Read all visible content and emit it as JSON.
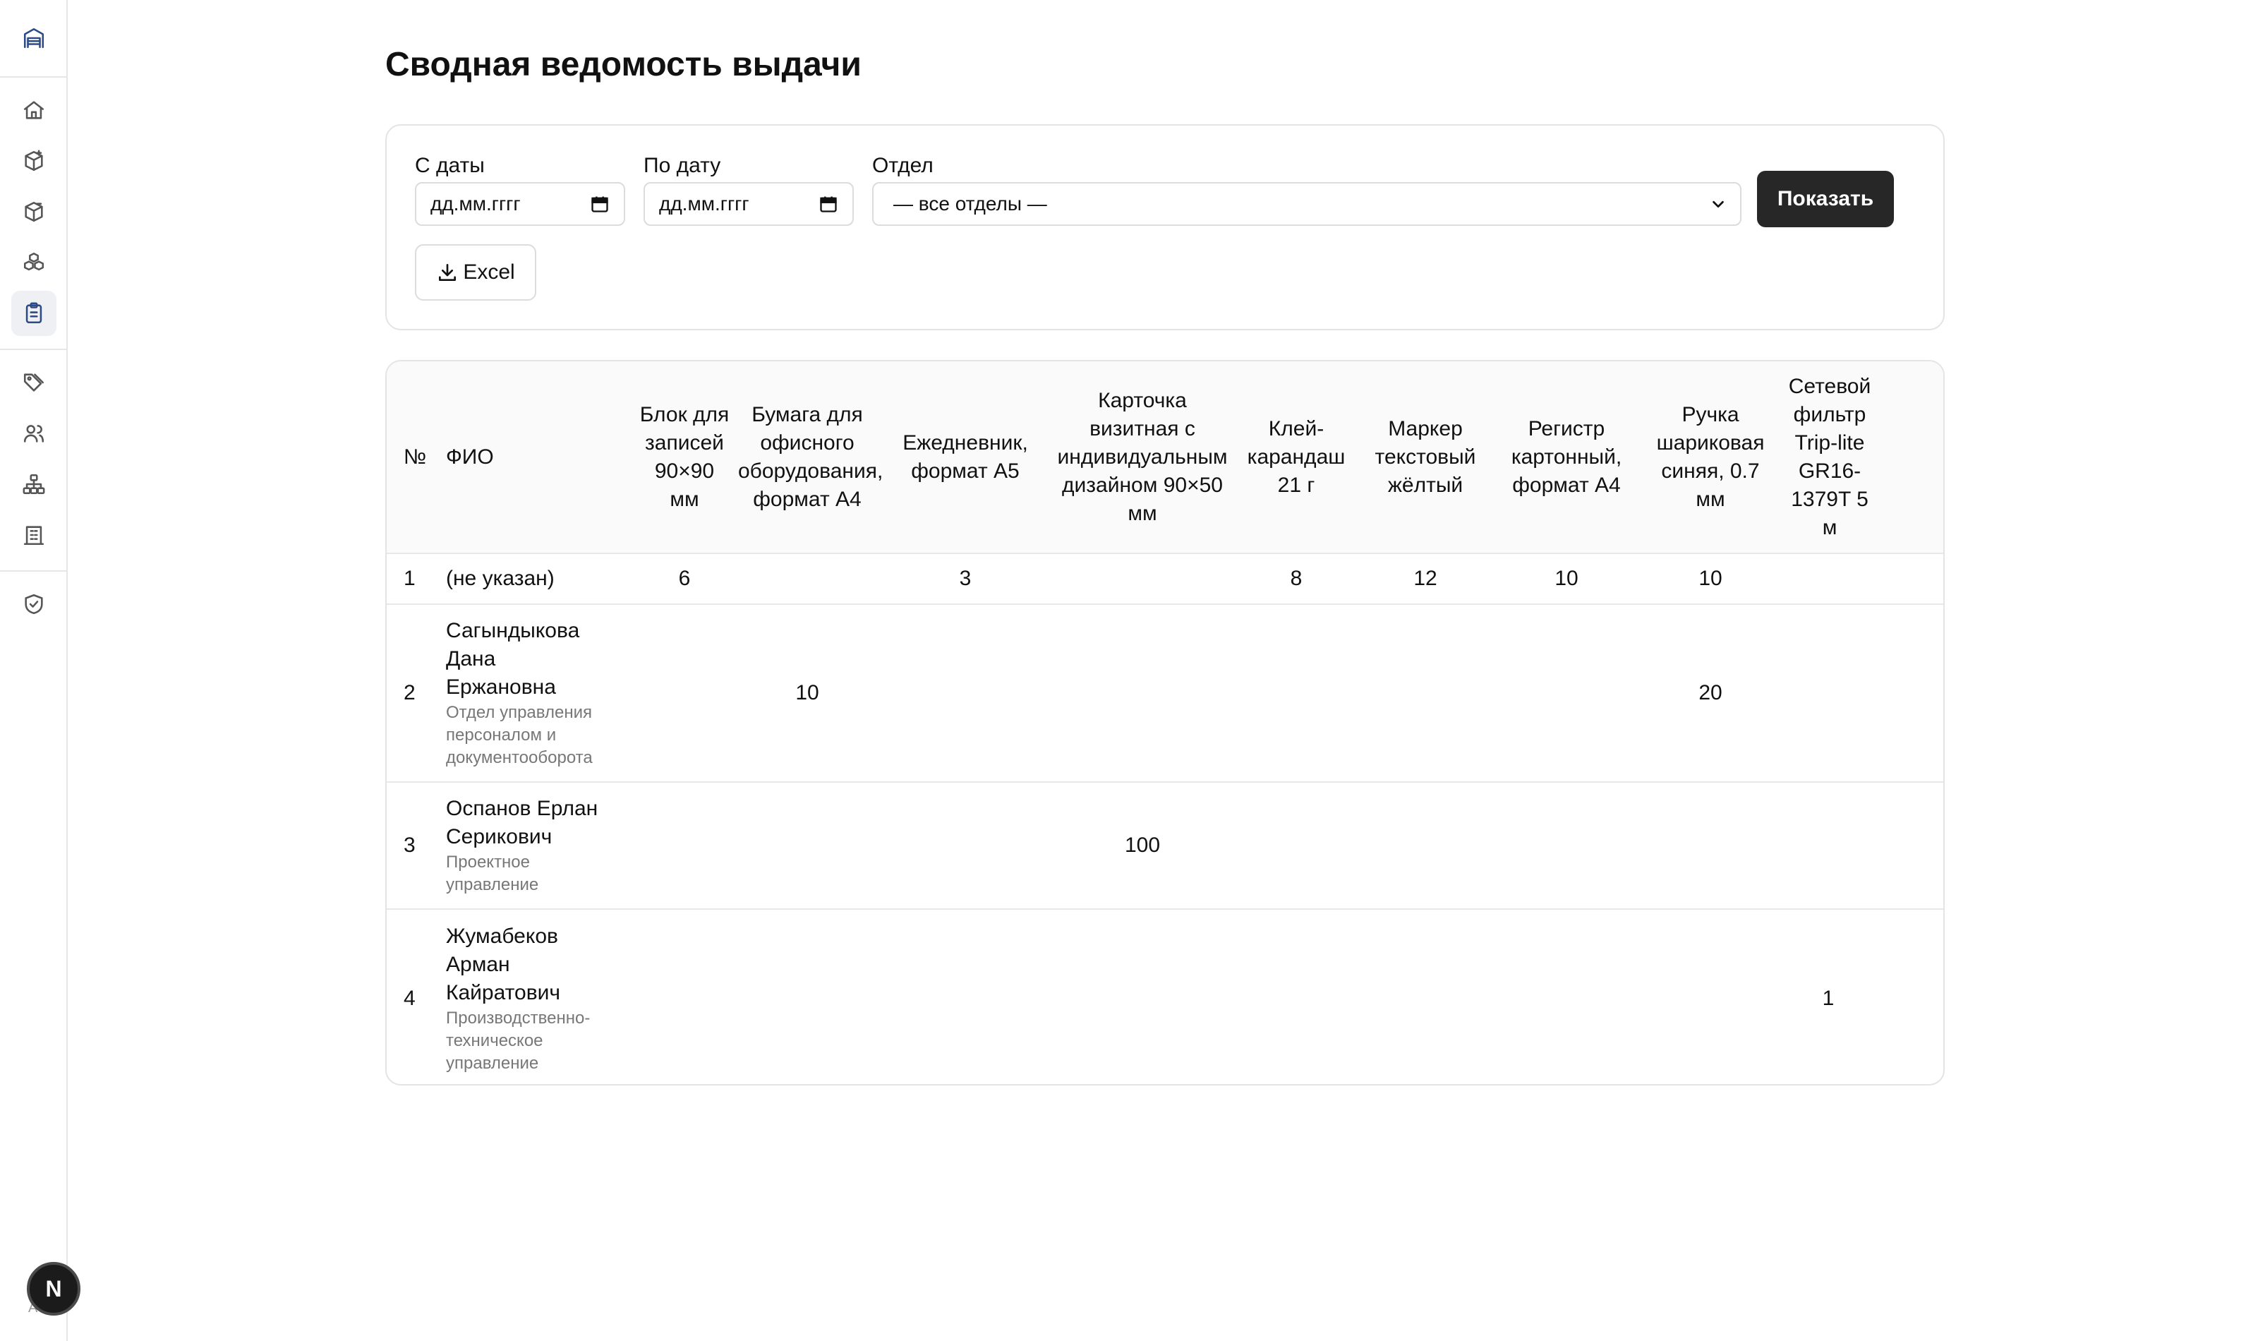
{
  "page": {
    "title": "Сводная ведомость выдачи"
  },
  "sidebar": {
    "items": [
      {
        "icon": "warehouse-icon"
      },
      {
        "icon": "home-icon"
      },
      {
        "icon": "box-plus-icon"
      },
      {
        "icon": "box-minus-icon"
      },
      {
        "icon": "boxes-icon"
      },
      {
        "icon": "clipboard-list-icon",
        "active": true
      },
      {
        "icon": "tags-icon"
      },
      {
        "icon": "users-icon"
      },
      {
        "icon": "org-chart-icon"
      },
      {
        "icon": "building-icon"
      },
      {
        "icon": "shield-check-icon"
      }
    ],
    "avatar_letter": "N",
    "avatar_sub": "А"
  },
  "filters": {
    "from_label": "С даты",
    "from_value": "дд.мм.гггг",
    "to_label": "По дату",
    "to_value": "дд.мм.гггг",
    "dept_label": "Отдел",
    "dept_value": "— все отделы —",
    "show_button": "Показать",
    "excel_button": "Excel"
  },
  "table": {
    "headers": [
      "№",
      "ФИО",
      "Блок для записей 90×90 мм",
      "Бумага для офисного оборудования, формат А4",
      "Ежедневник, формат А5",
      "Карточка визитная с индивидуальным дизайном 90×50 мм",
      "Клей-карандаш 21 г",
      "Маркер текстовый жёлтый",
      "Регистр картонный, формат А4",
      "Ручка шариковая синяя, 0.7 мм",
      "Сетевой фильтр Trip-lite GR16-1379T 5 м"
    ],
    "rows": [
      {
        "num": "1",
        "name": "(не указан)",
        "dept": "",
        "values": [
          "6",
          "",
          "3",
          "",
          "8",
          "12",
          "10",
          "10",
          ""
        ]
      },
      {
        "num": "2",
        "name": "Сагындыкова Дана Ержановна",
        "dept": "Отдел управления персоналом и документооборота",
        "values": [
          "",
          "10",
          "",
          "",
          "",
          "",
          "",
          "20",
          ""
        ]
      },
      {
        "num": "3",
        "name": "Оспанов Ерлан Серикович",
        "dept": "Проектное управление",
        "values": [
          "",
          "",
          "",
          "100",
          "",
          "",
          "",
          "",
          ""
        ]
      },
      {
        "num": "4",
        "name": "Жумабеков Арман Кайратович",
        "dept": "Производственно-техническое управление",
        "values": [
          "",
          "",
          "",
          "",
          "",
          "",
          "",
          "",
          "1"
        ]
      }
    ]
  }
}
